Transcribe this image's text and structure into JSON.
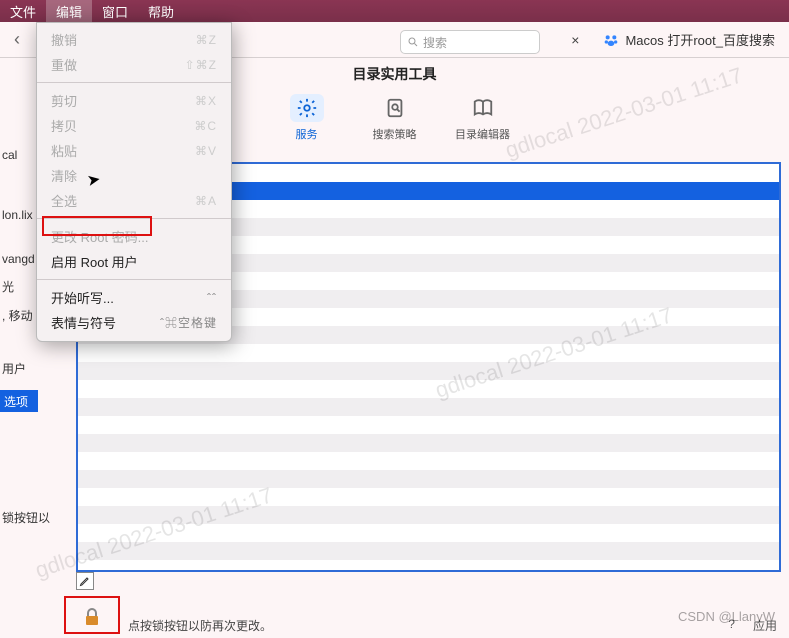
{
  "menubar": {
    "file": "文件",
    "edit": "编辑",
    "window": "窗口",
    "help": "帮助"
  },
  "browser": {
    "tab_close": "×",
    "baidu_tab": "Macos 打开root_百度搜索"
  },
  "window": {
    "title": "目录实用工具",
    "tools": {
      "services": "服务",
      "policy": "搜索策略",
      "dir_editor": "目录编辑器"
    },
    "search_placeholder": "搜索"
  },
  "edit_menu": {
    "undo": "撤销",
    "undo_sc": "⌘Z",
    "redo": "重做",
    "redo_sc": "⇧⌘Z",
    "cut": "剪切",
    "cut_sc": "⌘X",
    "copy": "拷贝",
    "copy_sc": "⌘C",
    "paste": "粘贴",
    "paste_sc": "⌘V",
    "clear": "清除",
    "select_all": "全选",
    "select_all_sc": "⌘A",
    "change_root": "更改 Root 密码...",
    "enable_root": "启用 Root 用户",
    "dictation": "开始听写...",
    "dictation_sc": "ˆˆ",
    "emoji": "表情与符号",
    "emoji_sc": "ˆ⌘空格键"
  },
  "left_fragments": {
    "a": "cal",
    "b": "lon.lix",
    "c": "vangd",
    "d": "光",
    "e": ", 移动",
    "f": "用户",
    "g": "选项",
    "h": "锁按钮以"
  },
  "footer": {
    "lock_hint": "点按锁按钮以防再次更改。",
    "help": "?",
    "apply": "应用"
  },
  "watermark_text": "gdlocal 2022-03-01 11:17",
  "csdn": "CSDN @LlanyW"
}
